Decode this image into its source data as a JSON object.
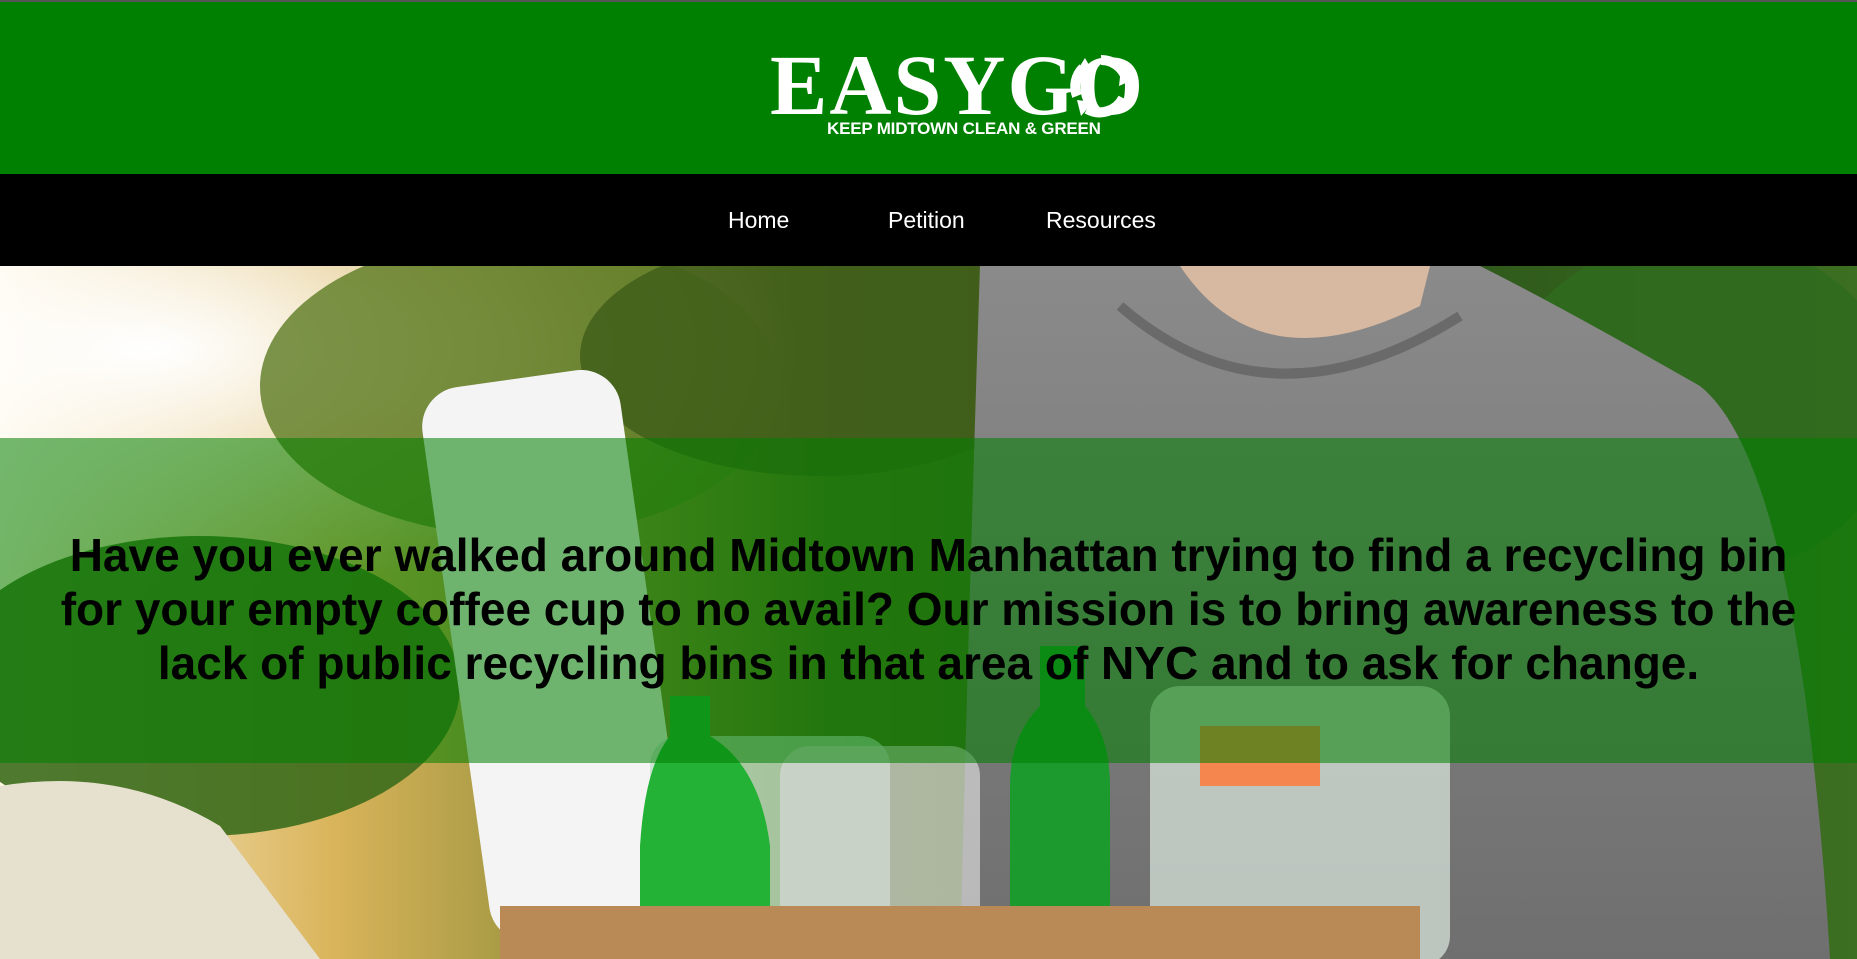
{
  "header": {
    "logo_word": "EASYGO",
    "logo_tagline": "KEEP MIDTOWN CLEAN & GREEN",
    "logo_icon": "recycle-icon",
    "background_color": "#008000"
  },
  "nav": {
    "background_color": "#000000",
    "items": [
      {
        "label": "Home"
      },
      {
        "label": "Petition"
      },
      {
        "label": "Resources"
      }
    ]
  },
  "hero": {
    "image_subject": "person holding box of recyclable bottles",
    "overlay_color": "#008000",
    "mission_text": "Have you ever walked around Midtown Manhattan trying to find a recycling bin for your empty coffee cup to no avail? Our mission is to bring awareness to the lack of public recycling bins in that area of NYC and to ask for change."
  }
}
